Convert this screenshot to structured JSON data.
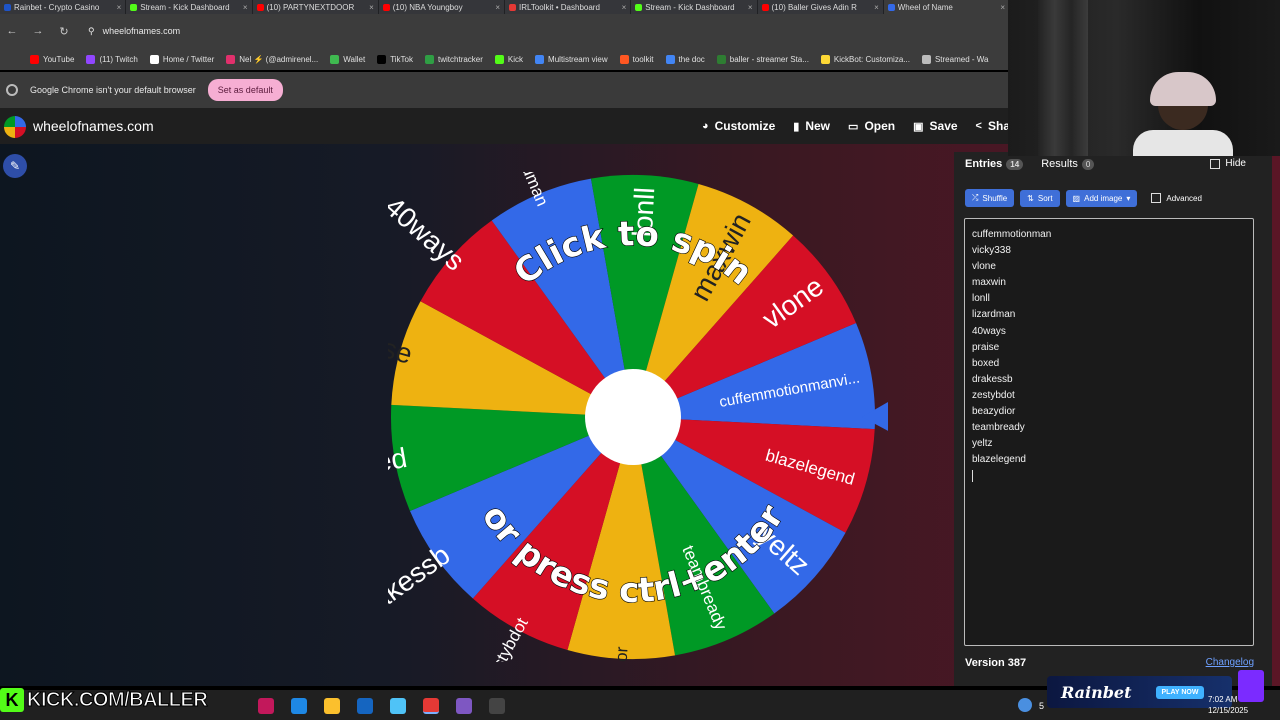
{
  "browser": {
    "tabs": [
      {
        "label": "Rainbet - Crypto Casino",
        "color": "#1e54c8"
      },
      {
        "label": "Stream - Kick Dashboard",
        "color": "#53fc18"
      },
      {
        "label": "(10) PARTYNEXTDOOR",
        "color": "#ff0000"
      },
      {
        "label": "(10) NBA Youngboy",
        "color": "#ff0000"
      },
      {
        "label": "IRLToolkit • Dashboard",
        "color": "#e53935"
      },
      {
        "label": "Stream - Kick Dashboard",
        "color": "#53fc18"
      },
      {
        "label": "(10) Baller Gives Adin R",
        "color": "#ff0000"
      },
      {
        "label": "Wheel of Name",
        "color": "#3369e8"
      }
    ],
    "url": "wheelofnames.com",
    "bookmarks": [
      {
        "label": "YouTube",
        "color": "#ff0000"
      },
      {
        "label": "(11) Twitch",
        "color": "#9146ff"
      },
      {
        "label": "Home / Twitter",
        "color": "#ffffff"
      },
      {
        "label": "Nel ⚡ (@admirenel...",
        "color": "#e1306c"
      },
      {
        "label": "Wallet",
        "color": "#3fb950"
      },
      {
        "label": "TikTok",
        "color": "#000000"
      },
      {
        "label": "twitchtracker",
        "color": "#2f9e44"
      },
      {
        "label": "Kick",
        "color": "#53fc18"
      },
      {
        "label": "Multistream view",
        "color": "#4285f4"
      },
      {
        "label": "toolkit",
        "color": "#ff5722"
      },
      {
        "label": "the doc",
        "color": "#4285f4"
      },
      {
        "label": "baller - streamer Sta...",
        "color": "#2e7d32"
      },
      {
        "label": "KickBot: Customiza...",
        "color": "#fdd835"
      },
      {
        "label": "Streamed - Wa",
        "color": "#bbbbbb"
      }
    ],
    "default_msg": "Google Chrome isn't your default browser",
    "set_default_label": "Set as default"
  },
  "site": {
    "name": "wheelofnames.com",
    "menu": [
      {
        "label": "Customize",
        "icon": "palette-icon",
        "glyph": "◕"
      },
      {
        "label": "New",
        "icon": "file-icon",
        "glyph": "▮"
      },
      {
        "label": "Open",
        "icon": "folder-icon",
        "glyph": "▭"
      },
      {
        "label": "Save",
        "icon": "save-icon",
        "glyph": "▣"
      },
      {
        "label": "Sha",
        "icon": "share-icon",
        "glyph": "<"
      }
    ]
  },
  "wheel": {
    "slices": [
      {
        "label": "cuffemmotionmanvi...",
        "color": "#3369e8"
      },
      {
        "label": "blazelegend",
        "color": "#d50f25"
      },
      {
        "label": "yeltz",
        "color": "#3369e8"
      },
      {
        "label": "teambready",
        "color": "#009925"
      },
      {
        "label": "beazydior",
        "color": "#eeb211"
      },
      {
        "label": "zestybdot",
        "color": "#d50f25"
      },
      {
        "label": "drakessb",
        "color": "#3369e8"
      },
      {
        "label": "boxed",
        "color": "#009925"
      },
      {
        "label": "praise",
        "color": "#eeb211"
      },
      {
        "label": "40ways",
        "color": "#d50f25"
      },
      {
        "label": "lizardman",
        "color": "#3369e8"
      },
      {
        "label": "lonll",
        "color": "#009925"
      },
      {
        "label": "maxwin",
        "color": "#eeb211"
      },
      {
        "label": "vlone",
        "color": "#d50f25"
      }
    ],
    "top_text": "Click to spin",
    "bottom_text": "or press ctrl+enter"
  },
  "panel": {
    "entries_tab": "Entries",
    "entries_count": "14",
    "results_tab": "Results",
    "results_count": "0",
    "hide_label": "Hide",
    "shuffle_label": "Shuffle",
    "sort_label": "Sort",
    "add_image_label": "Add image",
    "advanced_label": "Advanced",
    "entries": [
      "cuffemmotionman",
      "vicky338",
      "vlone",
      "maxwin",
      "lonll",
      "lizardman",
      "40ways",
      "praise",
      "boxed",
      "drakessb",
      "zestybdot",
      "beazydior",
      "teambready",
      "yeltz",
      "blazelegend"
    ],
    "version": "Version 387",
    "changelog": "Changelog"
  },
  "overlay": {
    "kick_text": "KICK.COM/BALLER",
    "rainbet_text": "Rainbet",
    "play_now": "PLAY NOW",
    "temp": "5",
    "time": "7:02 AM",
    "date": "12/15/2025"
  }
}
